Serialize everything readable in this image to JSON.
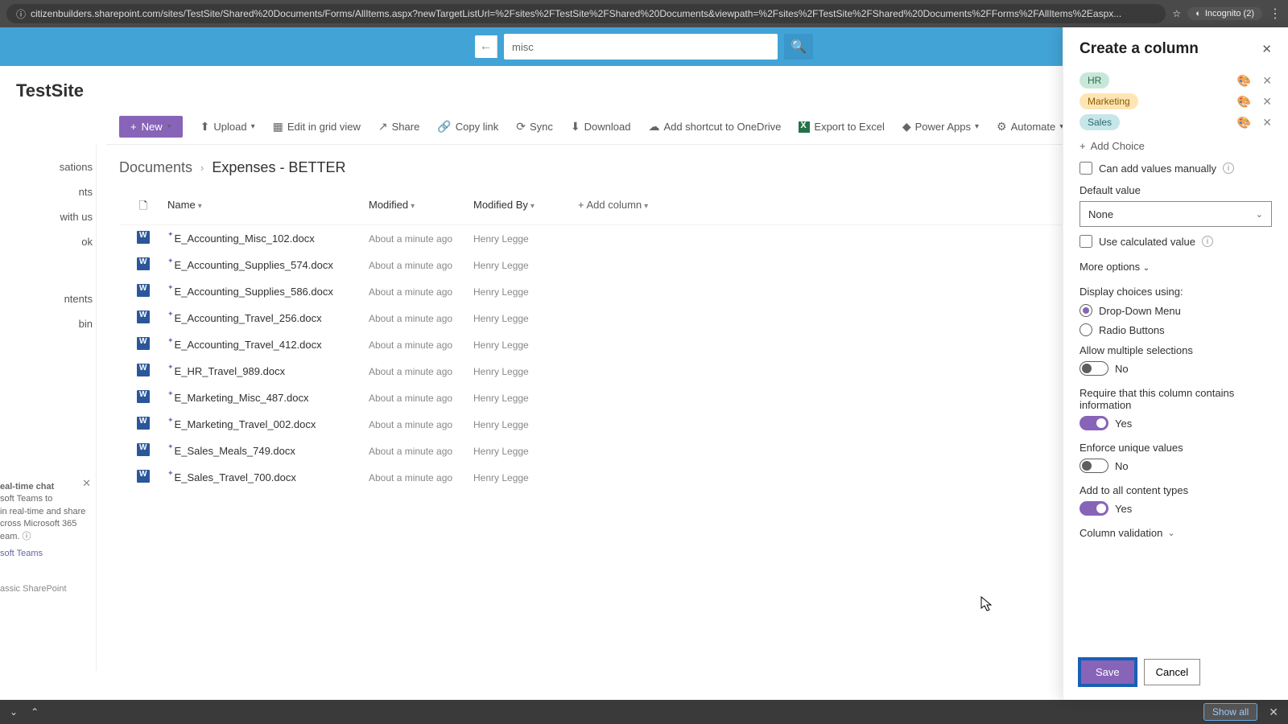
{
  "browser": {
    "url": "citizenbuilders.sharepoint.com/sites/TestSite/Shared%20Documents/Forms/AllItems.aspx?newTargetListUrl=%2Fsites%2FTestSite%2FShared%20Documents&viewpath=%2Fsites%2FTestSite%2FShared%20Documents%2FForms%2FAllItems%2Easpx...",
    "incognito": "Incognito (2)"
  },
  "header": {
    "search_value": "misc"
  },
  "site": {
    "title": "TestSite"
  },
  "cmd": {
    "new": "New",
    "upload": "Upload",
    "edit_grid": "Edit in grid view",
    "share": "Share",
    "copy_link": "Copy link",
    "sync": "Sync",
    "download": "Download",
    "shortcut": "Add shortcut to OneDrive",
    "excel": "Export to Excel",
    "power_apps": "Power Apps",
    "automate": "Automate"
  },
  "nav": {
    "items": [
      "sations",
      "nts",
      "with us",
      "ok",
      "",
      "ntents",
      "bin"
    ],
    "chat": {
      "title": "eal-time chat",
      "body": "soft Teams to\n in real-time and share\ncross Microsoft 365\neam.",
      "link": "soft Teams"
    },
    "classic": "assic SharePoint"
  },
  "breadcrumb": {
    "parent": "Documents",
    "current": "Expenses - BETTER"
  },
  "columns": {
    "name": "Name",
    "modified": "Modified",
    "modified_by": "Modified By",
    "add": "Add column"
  },
  "rows": [
    {
      "name": "E_Accounting_Misc_102.docx",
      "mod": "About a minute ago",
      "by": "Henry Legge"
    },
    {
      "name": "E_Accounting_Supplies_574.docx",
      "mod": "About a minute ago",
      "by": "Henry Legge"
    },
    {
      "name": "E_Accounting_Supplies_586.docx",
      "mod": "About a minute ago",
      "by": "Henry Legge"
    },
    {
      "name": "E_Accounting_Travel_256.docx",
      "mod": "About a minute ago",
      "by": "Henry Legge"
    },
    {
      "name": "E_Accounting_Travel_412.docx",
      "mod": "About a minute ago",
      "by": "Henry Legge"
    },
    {
      "name": "E_HR_Travel_989.docx",
      "mod": "About a minute ago",
      "by": "Henry Legge"
    },
    {
      "name": "E_Marketing_Misc_487.docx",
      "mod": "About a minute ago",
      "by": "Henry Legge"
    },
    {
      "name": "E_Marketing_Travel_002.docx",
      "mod": "About a minute ago",
      "by": "Henry Legge"
    },
    {
      "name": "E_Sales_Meals_749.docx",
      "mod": "About a minute ago",
      "by": "Henry Legge"
    },
    {
      "name": "E_Sales_Travel_700.docx",
      "mod": "About a minute ago",
      "by": "Henry Legge"
    }
  ],
  "panel": {
    "title": "Create a column",
    "choices": [
      {
        "label": "HR",
        "cls": "pill-hr"
      },
      {
        "label": "Marketing",
        "cls": "pill-mk"
      },
      {
        "label": "Sales",
        "cls": "pill-sl"
      }
    ],
    "add_choice": "Add Choice",
    "manual_values": "Can add values manually",
    "default_label": "Default value",
    "default_value": "None",
    "calc": "Use calculated value",
    "more": "More options",
    "display_label": "Display choices using:",
    "dropdown": "Drop-Down Menu",
    "radiobtns": "Radio Buttons",
    "allow_multi_label": "Allow multiple selections",
    "allow_multi_val": "No",
    "require_label": "Require that this column contains information",
    "require_val": "Yes",
    "unique_label": "Enforce unique values",
    "unique_val": "No",
    "content_types_label": "Add to all content types",
    "content_types_val": "Yes",
    "validation": "Column validation",
    "save": "Save",
    "cancel": "Cancel"
  },
  "bottom": {
    "show_all": "Show all"
  }
}
